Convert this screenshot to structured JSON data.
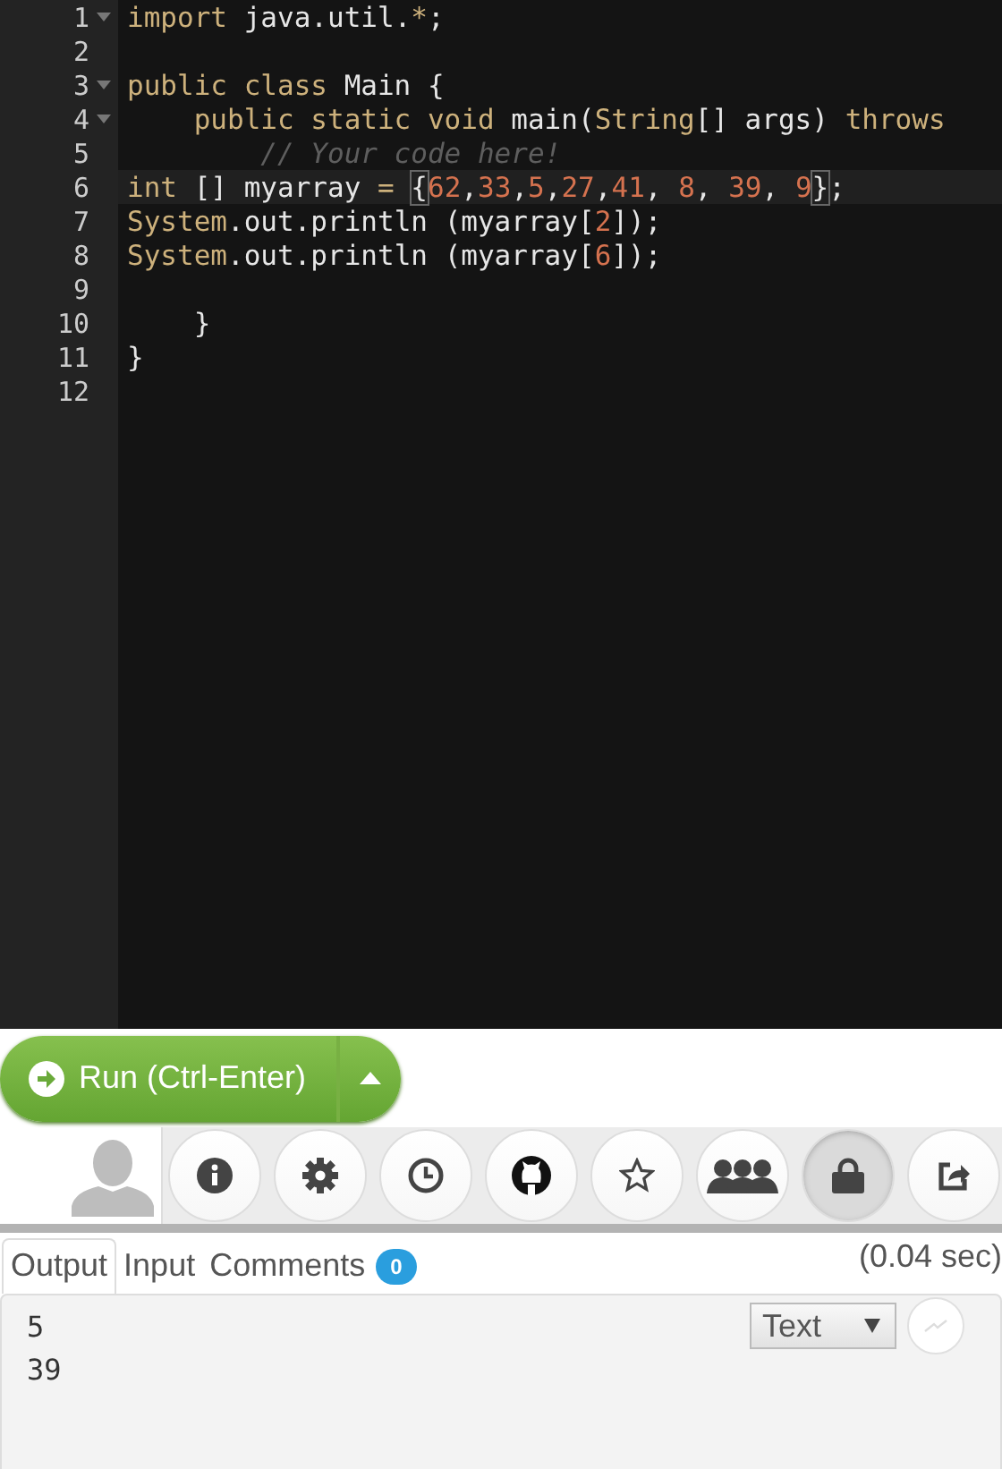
{
  "editor": {
    "lines": [
      {
        "number": "1",
        "foldable": true,
        "active": false,
        "tokens": [
          {
            "text": "import",
            "kind": "keyword"
          },
          {
            "text": " java.util.",
            "kind": "plain"
          },
          {
            "text": "*",
            "kind": "keyword"
          },
          {
            "text": ";",
            "kind": "plain"
          }
        ]
      },
      {
        "number": "2",
        "foldable": false,
        "active": false
      },
      {
        "number": "3",
        "foldable": true,
        "active": false,
        "tokens": [
          {
            "text": "public class",
            "kind": "keyword"
          },
          {
            "text": " Main {",
            "kind": "plain"
          }
        ]
      },
      {
        "number": "4",
        "foldable": true,
        "active": false,
        "tokens": [
          {
            "text": "    public static void",
            "kind": "keyword"
          },
          {
            "text": " main(",
            "kind": "plain"
          },
          {
            "text": "String",
            "kind": "keyword"
          },
          {
            "text": "[] args) ",
            "kind": "plain"
          },
          {
            "text": "throws",
            "kind": "keyword"
          }
        ]
      },
      {
        "number": "5",
        "foldable": false,
        "active": false,
        "tokens": [
          {
            "text": "        // Your code here!",
            "kind": "comment"
          }
        ]
      },
      {
        "number": "6",
        "foldable": false,
        "active": true,
        "tokens": [
          {
            "text": "int",
            "kind": "keyword"
          },
          {
            "text": " [] myarray ",
            "kind": "plain"
          },
          {
            "text": "= ",
            "kind": "keyword"
          },
          {
            "text": "{",
            "kind": "match"
          },
          {
            "text": "62",
            "kind": "number"
          },
          {
            "text": ",",
            "kind": "plain"
          },
          {
            "text": "33",
            "kind": "number"
          },
          {
            "text": ",",
            "kind": "plain"
          },
          {
            "text": "5",
            "kind": "number"
          },
          {
            "text": ",",
            "kind": "plain"
          },
          {
            "text": "27",
            "kind": "number"
          },
          {
            "text": ",",
            "kind": "plain"
          },
          {
            "text": "41",
            "kind": "number"
          },
          {
            "text": ", ",
            "kind": "plain"
          },
          {
            "text": "8",
            "kind": "number"
          },
          {
            "text": ", ",
            "kind": "plain"
          },
          {
            "text": "39",
            "kind": "number"
          },
          {
            "text": ", ",
            "kind": "plain"
          },
          {
            "text": "9",
            "kind": "number"
          },
          {
            "text": "}",
            "kind": "match"
          },
          {
            "text": ";",
            "kind": "plain"
          }
        ]
      },
      {
        "number": "7",
        "foldable": false,
        "active": false,
        "tokens": [
          {
            "text": "System",
            "kind": "keyword"
          },
          {
            "text": ".out.println (myarray[",
            "kind": "plain"
          },
          {
            "text": "2",
            "kind": "number"
          },
          {
            "text": "]);",
            "kind": "plain"
          }
        ]
      },
      {
        "number": "8",
        "foldable": false,
        "active": false,
        "tokens": [
          {
            "text": "System",
            "kind": "keyword"
          },
          {
            "text": ".out.println (myarray[",
            "kind": "plain"
          },
          {
            "text": "6",
            "kind": "number"
          },
          {
            "text": "]);",
            "kind": "plain"
          }
        ]
      },
      {
        "number": "9",
        "foldable": false,
        "active": false
      },
      {
        "number": "10",
        "foldable": false,
        "active": false,
        "tokens": [
          {
            "text": "    }",
            "kind": "plain"
          }
        ]
      },
      {
        "number": "11",
        "foldable": false,
        "active": false,
        "tokens": [
          {
            "text": "}",
            "kind": "plain"
          }
        ]
      },
      {
        "number": "12",
        "foldable": false,
        "active": false
      }
    ]
  },
  "run_button": {
    "label": "Run (Ctrl-Enter)"
  },
  "toolbar": [
    {
      "kind": "info",
      "selected": false
    },
    {
      "kind": "gear",
      "selected": false
    },
    {
      "kind": "clock",
      "selected": false
    },
    {
      "kind": "cat",
      "selected": false
    },
    {
      "kind": "star",
      "selected": false
    },
    {
      "kind": "people",
      "selected": false
    },
    {
      "kind": "lock",
      "selected": true
    },
    {
      "kind": "share",
      "selected": false
    }
  ],
  "tabs": [
    {
      "label": "Output",
      "selected": true
    },
    {
      "label": "Input",
      "selected": false
    },
    {
      "label": "Comments",
      "selected": false,
      "badge": "0"
    }
  ],
  "timing": "(0.04 sec)",
  "output": {
    "format": "Text",
    "lines": [
      "5",
      "39"
    ]
  }
}
